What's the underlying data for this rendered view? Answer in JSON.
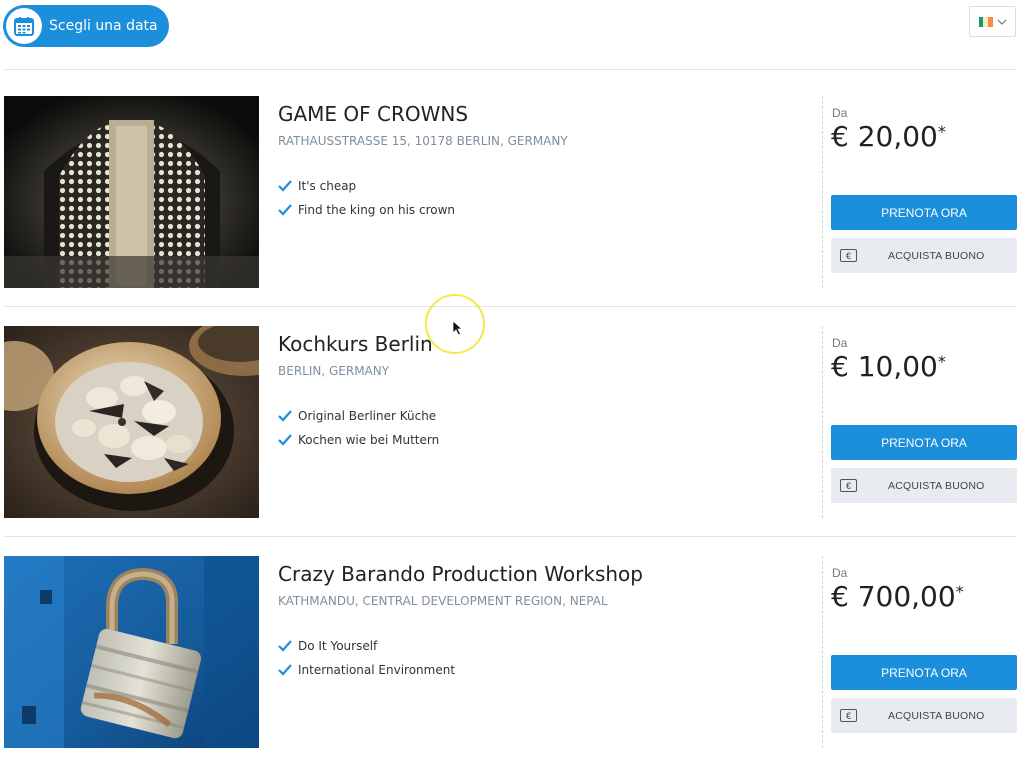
{
  "header": {
    "date_button_label": "Scegli una data",
    "language": {
      "flag_colors": [
        "#169b62",
        "#ffffff",
        "#ff883e"
      ]
    }
  },
  "colors": {
    "accent": "#1b8fdc",
    "voucher_bg": "#e8ebef",
    "check": "#1b8fdc"
  },
  "listings": [
    {
      "title": "GAME OF CROWNS",
      "address": "RATHAUSSTRASSE 15, 10178 BERLIN, GERMANY",
      "features": [
        "It's cheap",
        "Find the king on his crown"
      ],
      "from_label": "Da",
      "price": "€ 20,00",
      "price_mark": "*",
      "book_label": "PRENOTA ORA",
      "voucher_label": "ACQUISTA BUONO"
    },
    {
      "title": "Kochkurs Berlin",
      "address": "BERLIN, GERMANY",
      "features": [
        "Original Berliner Küche",
        "Kochen wie bei Muttern"
      ],
      "from_label": "Da",
      "price": "€ 10,00",
      "price_mark": "*",
      "book_label": "PRENOTA ORA",
      "voucher_label": "ACQUISTA BUONO"
    },
    {
      "title": "Crazy Barando Production Workshop",
      "address": "KATHMANDU, CENTRAL DEVELOPMENT REGION, NEPAL",
      "features": [
        "Do It Yourself",
        "International Environment"
      ],
      "from_label": "Da",
      "price": "€ 700,00",
      "price_mark": "*",
      "book_label": "PRENOTA ORA",
      "voucher_label": "ACQUISTA BUONO"
    }
  ],
  "icons": {
    "date_button": "calendar-icon",
    "language": "chevron-down-icon",
    "feature": "check-icon",
    "voucher": "euro-voucher-icon"
  }
}
